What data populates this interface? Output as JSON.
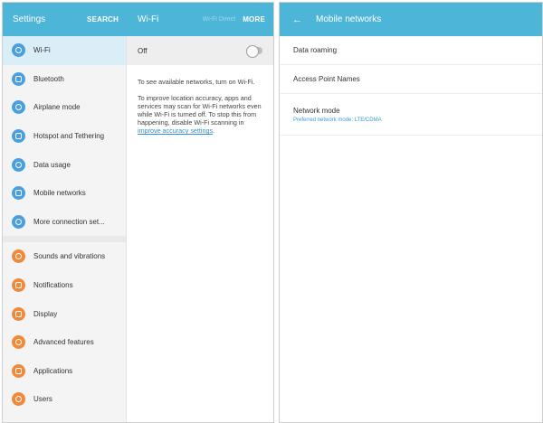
{
  "left_header": {
    "title": "Settings",
    "search": "SEARCH"
  },
  "wifi_header": {
    "title": "Wi-Fi",
    "faint": "Wi-Fi Direct",
    "more": "MORE"
  },
  "sidebar": {
    "items": [
      {
        "label": "Wi-Fi",
        "icon": "wifi-icon",
        "color": "#4a9fe0"
      },
      {
        "label": "Bluetooth",
        "icon": "bluetooth-icon",
        "color": "#4a9fe0"
      },
      {
        "label": "Airplane mode",
        "icon": "airplane-icon",
        "color": "#4a9fe0"
      },
      {
        "label": "Hotspot and Tethering",
        "icon": "hotspot-icon",
        "color": "#4a9fe0"
      },
      {
        "label": "Data usage",
        "icon": "data-usage-icon",
        "color": "#4a9fe0"
      },
      {
        "label": "Mobile networks",
        "icon": "mobile-networks-icon",
        "color": "#4a9fe0"
      },
      {
        "label": "More connection set...",
        "icon": "more-connection-icon",
        "color": "#4a9fe0"
      },
      {
        "label": "Sounds and vibrations",
        "icon": "sound-icon",
        "color": "#f08a3a"
      },
      {
        "label": "Notifications",
        "icon": "notifications-icon",
        "color": "#f08a3a"
      },
      {
        "label": "Display",
        "icon": "display-icon",
        "color": "#f08a3a"
      },
      {
        "label": "Advanced features",
        "icon": "advanced-features-icon",
        "color": "#f08a3a"
      },
      {
        "label": "Applications",
        "icon": "applications-icon",
        "color": "#f08a3a"
      },
      {
        "label": "Users",
        "icon": "users-icon",
        "color": "#f08a3a"
      }
    ]
  },
  "wifi_panel": {
    "toggle_label": "Off",
    "toggle_on": false,
    "text1": "To see available networks, turn on Wi-Fi.",
    "text2": "To improve location accuracy, apps and services may scan for Wi-Fi networks even while Wi-Fi is turned off. To stop this from happening, disable Wi-Fi scanning in",
    "link": "improve accuracy settings",
    "link_tail": "."
  },
  "mobile_networks": {
    "title": "Mobile networks",
    "rows": [
      {
        "label": "Data roaming"
      },
      {
        "label": "Access Point Names"
      },
      {
        "label": "Network mode",
        "sub": "Preferred network mode: LTE/CDMA"
      }
    ]
  },
  "colors": {
    "accent": "#4db6d8",
    "active_row": "#d9eef6",
    "connect_icon": "#4a9fe0",
    "device_icon": "#f08a3a",
    "link": "#2f8fd0"
  }
}
